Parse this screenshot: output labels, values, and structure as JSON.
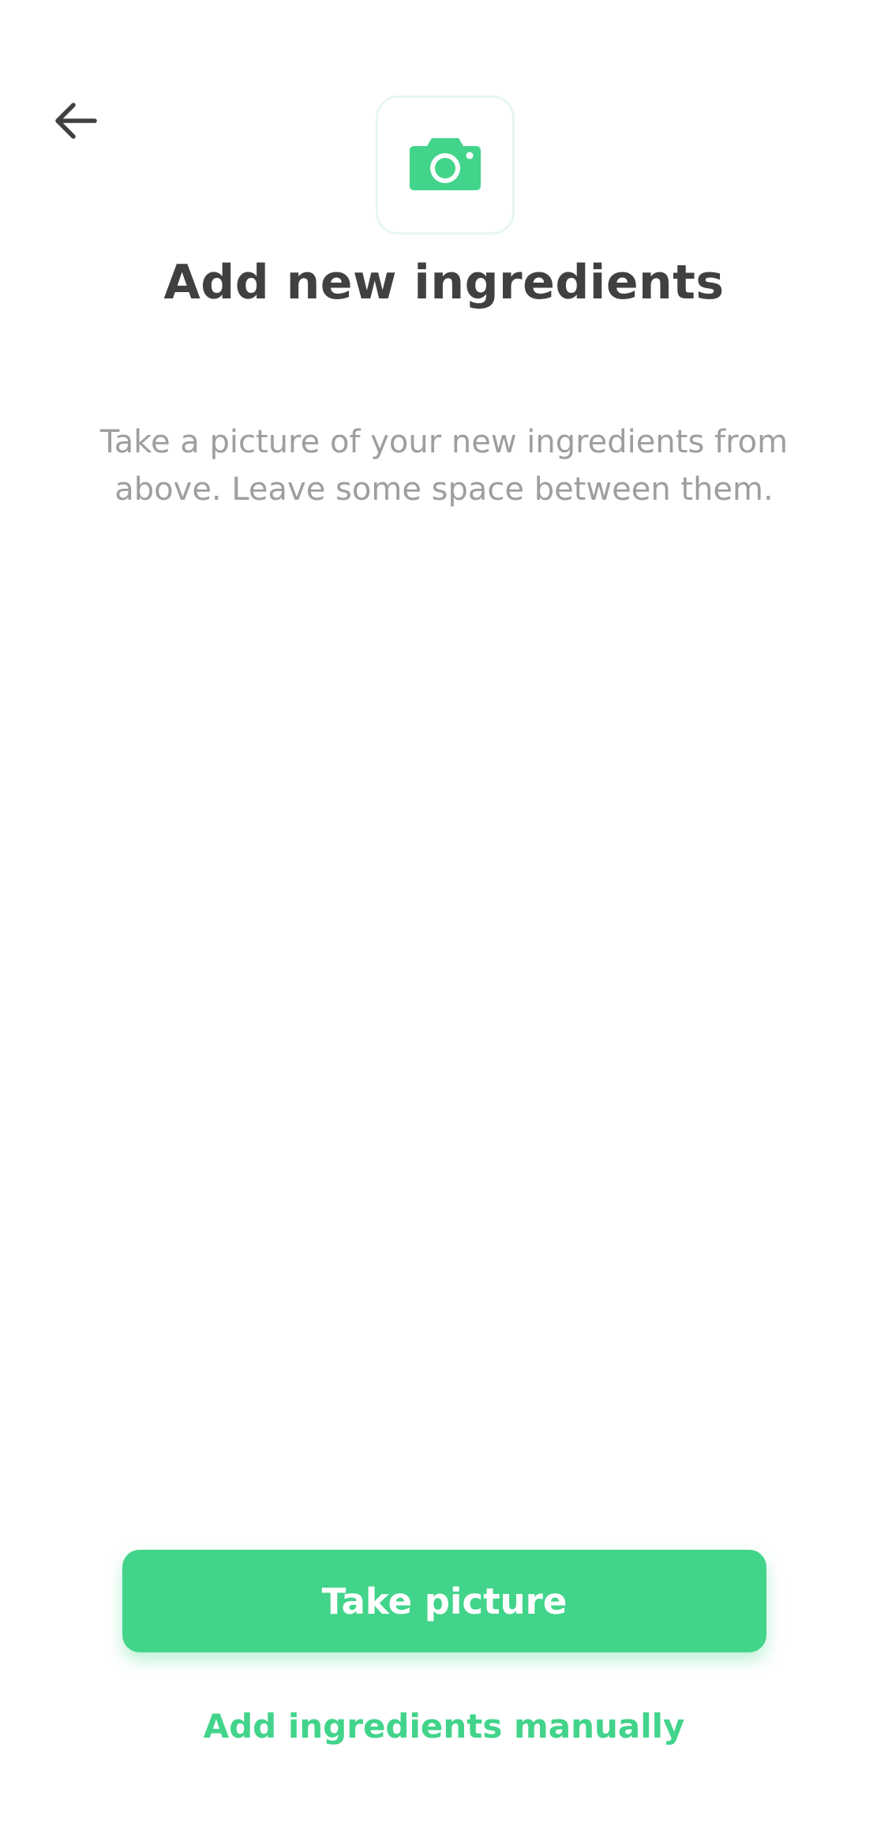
{
  "header": {
    "back_icon": "arrow-left-icon",
    "camera_icon": "camera-icon"
  },
  "main": {
    "title": "Add new ingredients",
    "description": "Take a picture of your new ingredients from above. Leave some space between them."
  },
  "actions": {
    "take_picture_label": "Take picture",
    "manual_label": "Add ingredients manually"
  },
  "colors": {
    "accent": "#42d48a",
    "title": "#404040",
    "description": "#9e9e9e"
  }
}
